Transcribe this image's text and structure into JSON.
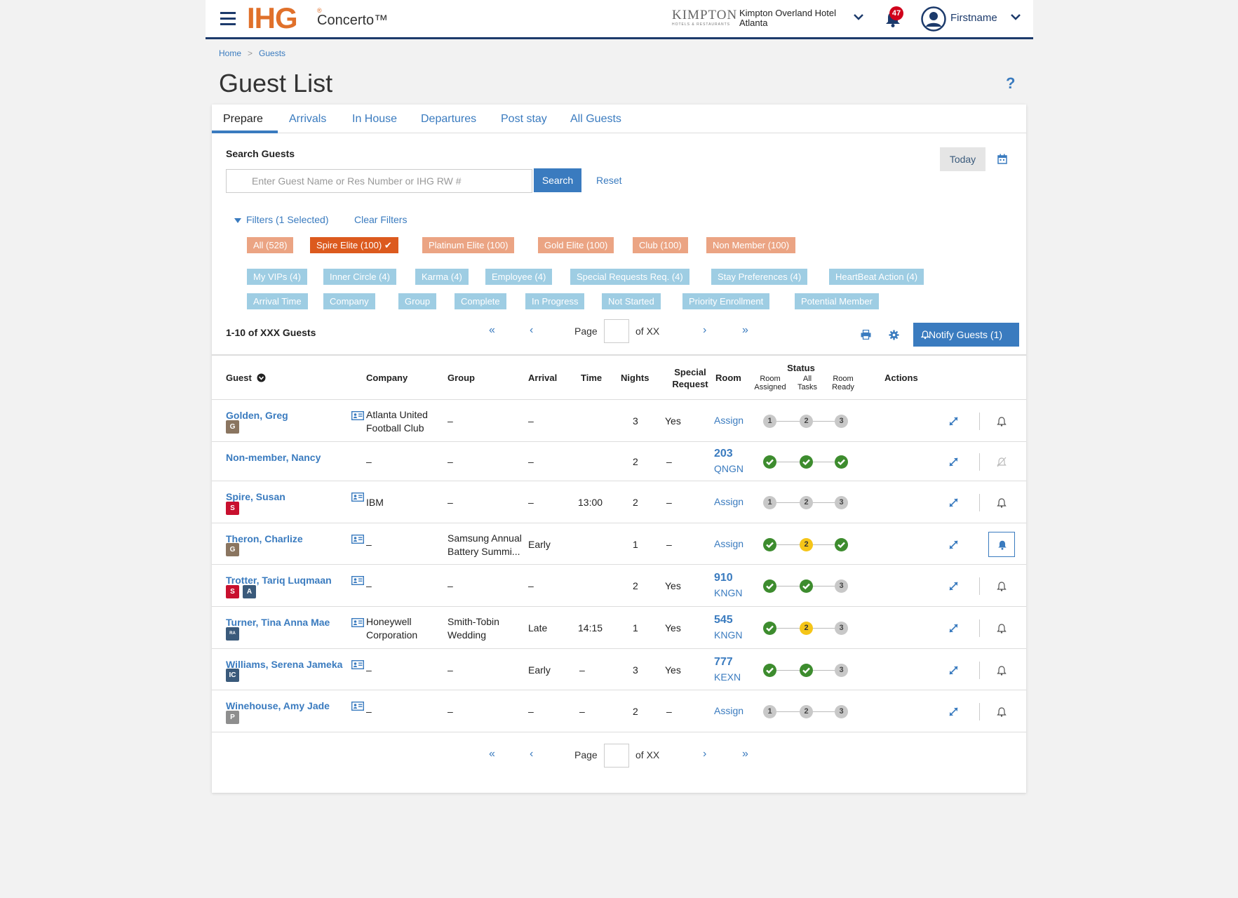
{
  "header": {
    "logo_text": "IHG",
    "logo_reg": "®",
    "product_name": "Concerto™",
    "brand": "KIMPTON",
    "brand_sub": "HOTELS & RESTAURANTS",
    "hotel_name": "Kimpton Overland Hotel",
    "hotel_city": "Atlanta",
    "notification_count": "47",
    "user_name": "Firstname"
  },
  "breadcrumb": [
    "Home",
    ">",
    "Guests"
  ],
  "page_title": "Guest List",
  "help_label": "?",
  "tabs": [
    "Prepare",
    "Arrivals",
    "In House",
    "Departures",
    "Post stay",
    "All Guests"
  ],
  "active_tab": "Prepare",
  "search": {
    "label": "Search Guests",
    "placeholder": "Enter Guest Name or Res Number or IHG RW #",
    "value": "",
    "button": "Search",
    "reset": "Reset",
    "today": "Today"
  },
  "filters": {
    "toggle": "Filters (1 Selected)",
    "clear": "Clear Filters",
    "membership": [
      "All (528)",
      "Spire  Elite (100)",
      "Platinum Elite (100)",
      "Gold Elite (100)",
      "Club (100)",
      "Non Member (100)"
    ],
    "selected_membership": "Spire  Elite (100)",
    "selected_mark": "✔",
    "attributes_row1": [
      "My VIPs (4)",
      "Inner Circle (4)",
      "Karma (4)",
      "Employee (4)",
      "Special Requests Req. (4)",
      "Stay Preferences (4)",
      "HeartBeat Action (4)"
    ],
    "attributes_row2": [
      "Arrival Time",
      "Company",
      "Group",
      "Complete",
      "In Progress",
      "Not Started",
      "Priority Enrollment",
      "Potential Member"
    ]
  },
  "pagination": {
    "count": "1-10 of XXX Guests",
    "first": "«",
    "prev": "‹",
    "page_label": "Page",
    "of_label": "of XX",
    "next": "›",
    "last": "»"
  },
  "notify_button": "Notify Guests (1)",
  "table": {
    "columns": {
      "guest": "Guest",
      "company": "Company",
      "group": "Group",
      "arrival": "Arrival",
      "time": "Time",
      "nights": "Nights",
      "special_1": "Special",
      "special_2": "Request",
      "room": "Room",
      "status": "Status",
      "status_1a": "Room",
      "status_1b": "Assigned",
      "status_2a": "All",
      "status_2b": "Tasks",
      "status_3a": "Room",
      "status_3b": "Ready",
      "actions": "Actions"
    },
    "assign_label": "Assign",
    "rows": [
      {
        "name": "Golden, Greg",
        "tiers": [
          "gold"
        ],
        "tier_labels": [
          "G"
        ],
        "company": [
          "Atlanta United",
          "Football Club"
        ],
        "group": [
          "–"
        ],
        "arrival": "–",
        "time": "",
        "nights": "3",
        "special": "Yes",
        "room": null,
        "room_code": null,
        "status": [
          "pending",
          "pending",
          "pending"
        ],
        "notify": "bell",
        "card": true
      },
      {
        "name": "Non-member, Nancy",
        "tiers": [],
        "tier_labels": [],
        "company": [
          "–"
        ],
        "group": [
          "–"
        ],
        "arrival": "–",
        "time": "",
        "nights": "2",
        "special": "–",
        "room": "203",
        "room_code": "QNGN",
        "status": [
          "done",
          "done",
          "done"
        ],
        "notify": "bell-off",
        "card": false
      },
      {
        "name": "Spire, Susan",
        "tiers": [
          "spire"
        ],
        "tier_labels": [
          "S"
        ],
        "company": [
          "IBM"
        ],
        "group": [
          "–"
        ],
        "arrival": "–",
        "time": "13:00",
        "nights": "2",
        "special": "–",
        "room": null,
        "room_code": null,
        "status": [
          "pending",
          "pending",
          "pending"
        ],
        "notify": "bell",
        "card": true
      },
      {
        "name": "Theron, Charlize",
        "tiers": [
          "gold"
        ],
        "tier_labels": [
          "G"
        ],
        "company": [
          "–"
        ],
        "group": [
          "Samsung Annual",
          "Battery Summi..."
        ],
        "arrival": "Early",
        "time": "",
        "nights": "1",
        "special": "–",
        "room": null,
        "room_code": null,
        "status": [
          "done",
          "progress",
          "done"
        ],
        "notify": "bell-active",
        "card": true
      },
      {
        "name": "Trotter, Tariq Luqmaan",
        "tiers": [
          "spire",
          "ambassador"
        ],
        "tier_labels": [
          "S",
          "A"
        ],
        "company": [
          "–"
        ],
        "group": [
          "–"
        ],
        "arrival": "–",
        "time": "",
        "nights": "2",
        "special": "Yes",
        "room": "910",
        "room_code": "KNGN",
        "status": [
          "done",
          "done",
          "pending"
        ],
        "notify": "bell",
        "card": true
      },
      {
        "name": "Turner, Tina Anna Mae",
        "tiers": [
          "rca"
        ],
        "tier_labels": [
          "RA"
        ],
        "company": [
          "Honeywell",
          "Corporation"
        ],
        "group": [
          "Smith-Tobin",
          "Wedding"
        ],
        "arrival": "Late",
        "time": "14:15",
        "nights": "1",
        "special": "Yes",
        "room": "545",
        "room_code": "KNGN",
        "status": [
          "done",
          "progress",
          "pending"
        ],
        "notify": "bell",
        "card": true
      },
      {
        "name": "Williams, Serena Jameka",
        "tiers": [
          "ic"
        ],
        "tier_labels": [
          "IC"
        ],
        "company": [
          "–"
        ],
        "group": [
          "–"
        ],
        "arrival": "Early",
        "time": "–",
        "nights": "3",
        "special": "Yes",
        "room": "777",
        "room_code": "KEXN",
        "status": [
          "done",
          "done",
          "pending"
        ],
        "notify": "bell",
        "card": true
      },
      {
        "name": "Winehouse, Amy Jade",
        "tiers": [
          "platinum"
        ],
        "tier_labels": [
          "P"
        ],
        "company": [
          "–"
        ],
        "group": [
          "–"
        ],
        "arrival": "–",
        "time": "–",
        "nights": "2",
        "special": "–",
        "room": null,
        "room_code": null,
        "status": [
          "pending",
          "pending",
          "pending"
        ],
        "notify": "bell",
        "card": true
      }
    ]
  },
  "colors": {
    "accent": "#3a7bbf",
    "navy": "#1c3a6b",
    "orange": "#dc5a1e",
    "success": "#3d8c2e",
    "warning": "#f5c518"
  }
}
